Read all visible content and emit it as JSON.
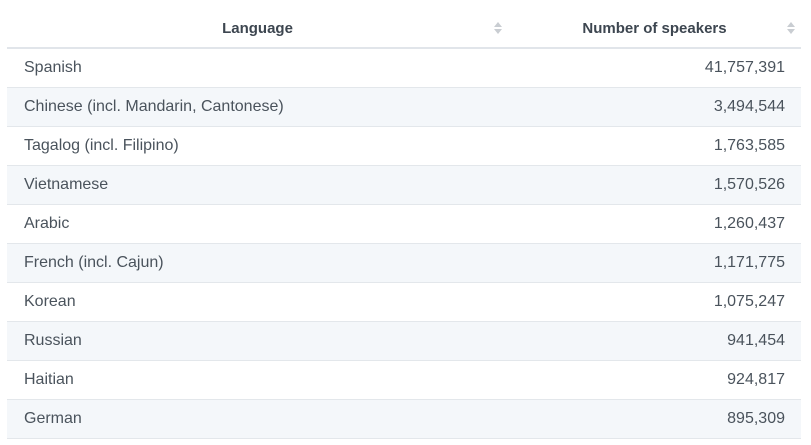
{
  "table": {
    "headers": [
      "Language",
      "Number of speakers"
    ],
    "rows": [
      {
        "language": "Spanish",
        "speakers": "41,757,391"
      },
      {
        "language": "Chinese (incl. Mandarin, Cantonese)",
        "speakers": "3,494,544"
      },
      {
        "language": "Tagalog (incl. Filipino)",
        "speakers": "1,763,585"
      },
      {
        "language": "Vietnamese",
        "speakers": "1,570,526"
      },
      {
        "language": "Arabic",
        "speakers": "1,260,437"
      },
      {
        "language": "French (incl. Cajun)",
        "speakers": "1,171,775"
      },
      {
        "language": "Korean",
        "speakers": "1,075,247"
      },
      {
        "language": "Russian",
        "speakers": "941,454"
      },
      {
        "language": "Haitian",
        "speakers": "924,817"
      },
      {
        "language": "German",
        "speakers": "895,309"
      }
    ]
  },
  "icons": {
    "sort": "sort-updown-icon"
  },
  "colors": {
    "header_text": "#3d4650",
    "row_alt_bg": "#f4f7fa",
    "cell_text": "#4a535c",
    "sort_icon": "#c9cdd2"
  }
}
